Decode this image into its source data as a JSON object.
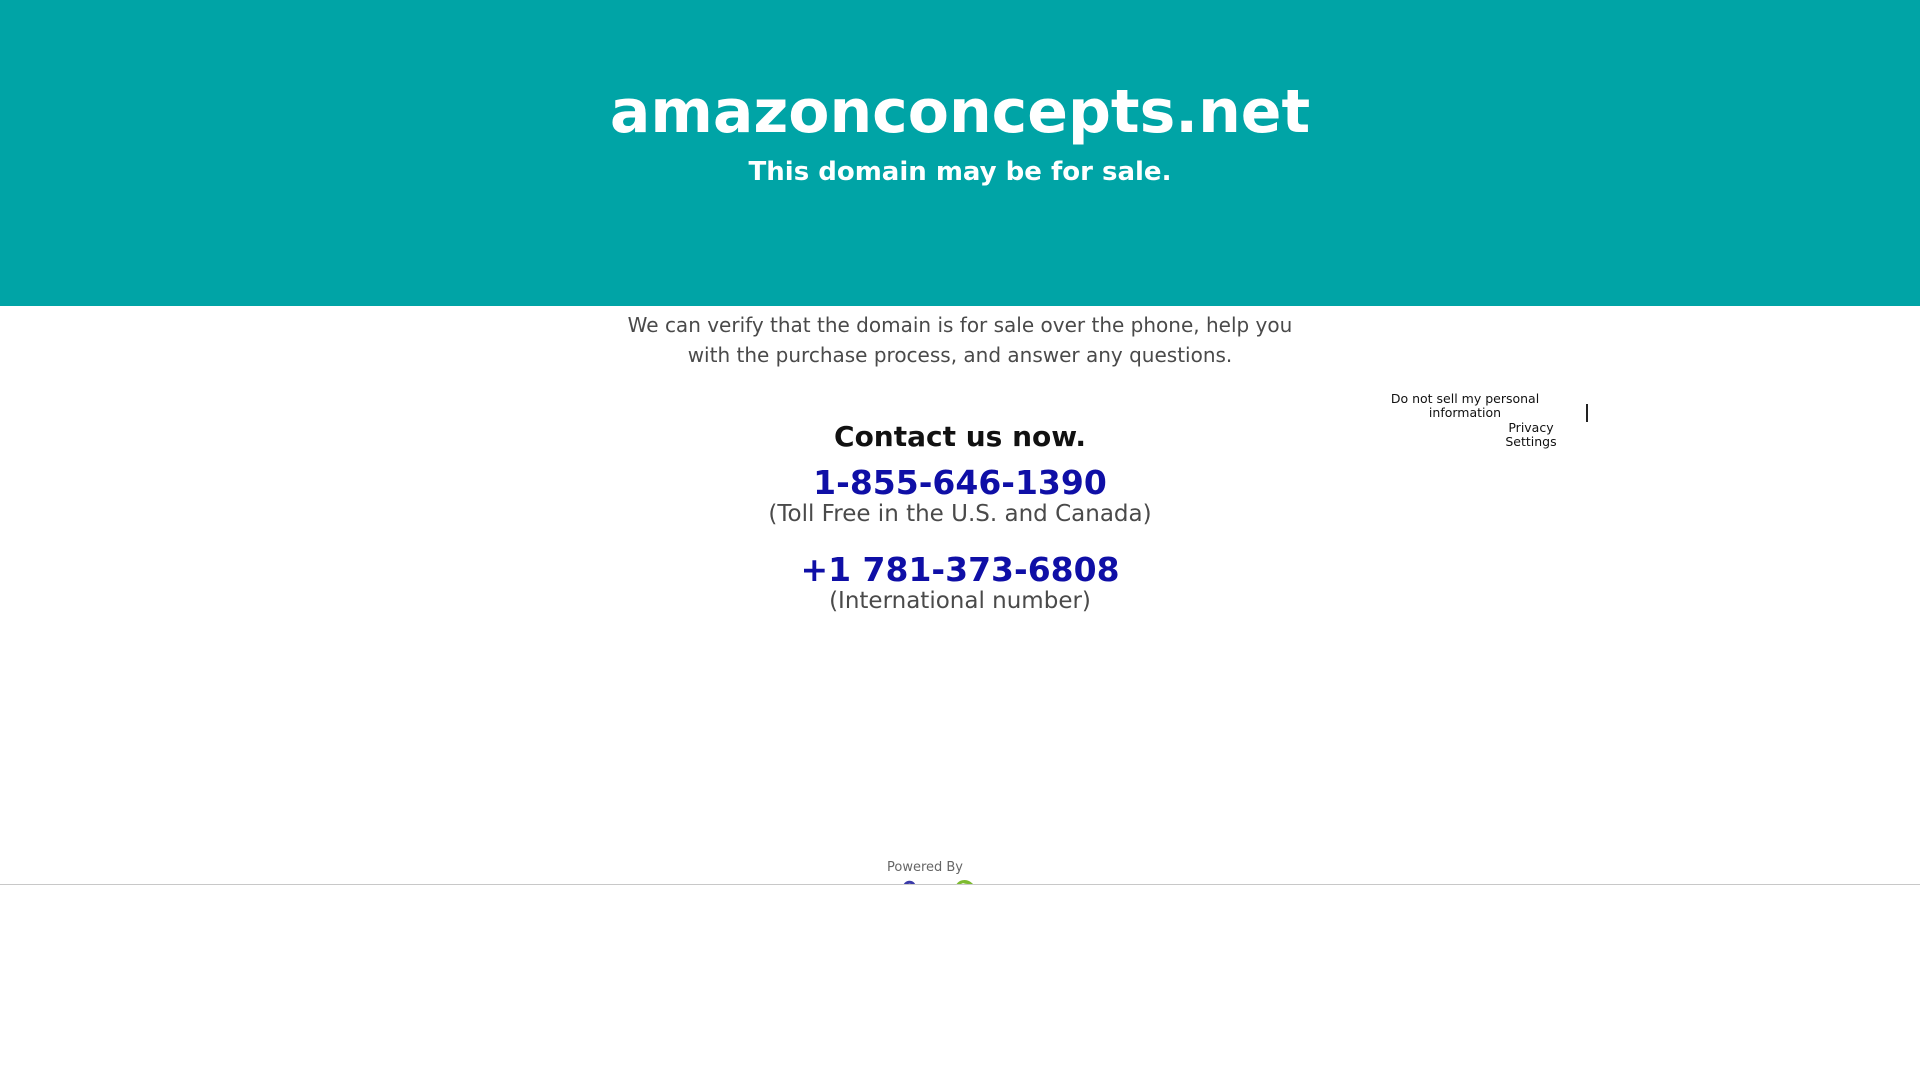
{
  "header": {
    "domain": "amazonconcepts.net",
    "subtitle": "This domain may be for sale.",
    "background_color": "#00a4a6"
  },
  "main": {
    "verify_text": "We can verify that the domain is for sale over the phone, help you with the purchase process, and answer any questions.",
    "contact_heading": "Contact us now.",
    "phones": [
      {
        "number": "1-855-646-1390",
        "note": "(Toll Free in the U.S. and Canada)"
      },
      {
        "number": "+1 781-373-6808",
        "note": "(International number)"
      }
    ],
    "phone_color": "#0f0fa6"
  },
  "privacy": {
    "do_not_sell": "Do not sell my personal information",
    "settings": "Privacy Settings"
  },
  "footer": {
    "powered_by": "Powered By",
    "logo_icon": "brand-logo-icon"
  }
}
